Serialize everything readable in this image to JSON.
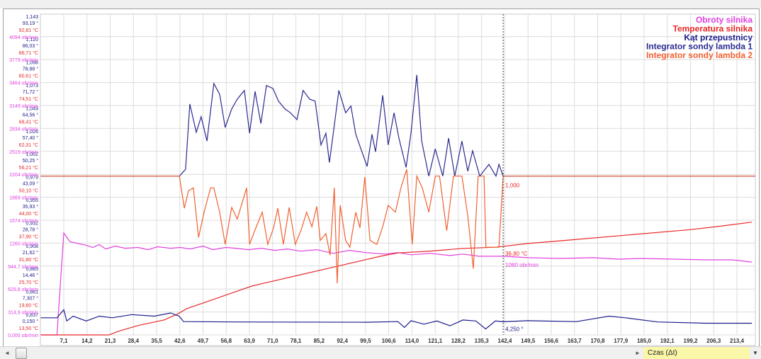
{
  "legend": [
    {
      "name": "Obroty silnika",
      "color": "#e040e0"
    },
    {
      "name": "Temperatura silnika",
      "color": "#e82828"
    },
    {
      "name": "Kąt przepustnicy",
      "color": "#1c1c8c"
    },
    {
      "name": "Integrator sondy lambda 1",
      "color": "#2a2a90"
    },
    {
      "name": "Integrator sondy lambda 2",
      "color": "#f06030"
    }
  ],
  "bottom": {
    "axis_select": "Czas (Δt)",
    "scroll_left": "◄",
    "scroll_right": "►",
    "dropdown": "▼"
  },
  "chart_data": {
    "type": "line",
    "xlabel": "Czas (Δt)",
    "xlim": [
      0,
      220
    ],
    "x_ticks": [
      "7,1",
      "14,2",
      "21,3",
      "28,4",
      "35,5",
      "42,6",
      "49,7",
      "56,8",
      "63,9",
      "71,0",
      "78,1",
      "85,2",
      "92,4",
      "99,5",
      "106,6",
      "114,0",
      "121,1",
      "128,2",
      "135,3",
      "142,4",
      "149,5",
      "156,6",
      "163,7",
      "170,8",
      "177,9",
      "185,0",
      "192,1",
      "199,2",
      "206,3",
      "213,4"
    ],
    "y_axes": {
      "lambda": {
        "min": 0.837,
        "step": 0.02355,
        "color": "#1c1c8c",
        "ticks": [
          "0,837",
          "0,861",
          "0,885",
          "0,908",
          "0,932",
          "0,955",
          "0,979",
          "1,002",
          "1,026",
          "1,049",
          "1,073",
          "1,096",
          "1,120",
          "1,143"
        ]
      },
      "angle": {
        "min": 0.15,
        "step": 7.157,
        "color": "#1c1c8c",
        "ticks": [
          "0,150 °",
          "7,307 °",
          "14,46 °",
          "21,62 °",
          "28,78 °",
          "35,93 °",
          "43,09 °",
          "50,25 °",
          "57,40 °",
          "64,56 °",
          "71,72 °",
          "78,88 °",
          "86,03 °",
          "93,19 °"
        ]
      },
      "temp": {
        "min": 13.5,
        "step": 6.1,
        "color": "#e82828",
        "ticks": [
          "13,50 °C",
          "19,60 °C",
          "25,70 °C",
          "31,80 °C",
          "37,90 °C",
          "44,00 °C",
          "50,10 °C",
          "56,21 °C",
          "62,31 °C",
          "68,41 °C",
          "74,51 °C",
          "80,61 °C",
          "86,71 °C",
          "92,81 °C"
        ]
      },
      "rpm": {
        "min": 0,
        "step": 314.9,
        "color": "#e040e0",
        "ticks": [
          "0,000 obr/min",
          "314,9 obr/min",
          "629,8 obr/min",
          "944,7 obr/min",
          "1260 obr/min",
          "1574 obr/min",
          "1889 obr/min",
          "2204 obr/min",
          "2519 obr/min",
          "2834 obr/min",
          "3149 obr/min",
          "3464 obr/min",
          "3779 obr/min",
          "4094 obr/min"
        ]
      }
    },
    "cursor": {
      "x": 142.4,
      "labels": [
        {
          "text": "1,000",
          "color": "#e82828",
          "axis": "lambda",
          "value": 0.995
        },
        {
          "text": "36,80 °C",
          "color": "#e82828",
          "axis": "temp",
          "value": 36.3
        },
        {
          "text": "1080 obr/min",
          "color": "#e040e0",
          "axis": "rpm",
          "value": 1020
        },
        {
          "text": "4,250 °",
          "color": "#1c1c8c",
          "axis": "angle",
          "value": 3.4
        }
      ]
    },
    "series": [
      {
        "name": "Obroty silnika",
        "axis": "rpm",
        "color": "#e040e0",
        "points": [
          [
            0,
            0
          ],
          [
            5,
            0
          ],
          [
            7.1,
            1400
          ],
          [
            9,
            1280
          ],
          [
            12,
            1250
          ],
          [
            14,
            1230
          ],
          [
            16,
            1200
          ],
          [
            18,
            1240
          ],
          [
            20,
            1180
          ],
          [
            23,
            1220
          ],
          [
            26,
            1190
          ],
          [
            30,
            1200
          ],
          [
            33,
            1170
          ],
          [
            36,
            1210
          ],
          [
            40,
            1190
          ],
          [
            43,
            1200
          ],
          [
            46,
            1180
          ],
          [
            50,
            1220
          ],
          [
            53,
            1170
          ],
          [
            57,
            1200
          ],
          [
            60,
            1190
          ],
          [
            64,
            1170
          ],
          [
            68,
            1190
          ],
          [
            72,
            1160
          ],
          [
            76,
            1180
          ],
          [
            80,
            1150
          ],
          [
            85,
            1170
          ],
          [
            90,
            1120
          ],
          [
            95,
            1160
          ],
          [
            100,
            1130
          ],
          [
            106,
            1110
          ],
          [
            110,
            1130
          ],
          [
            114,
            1100
          ],
          [
            120,
            1120
          ],
          [
            126,
            1090
          ],
          [
            130,
            1110
          ],
          [
            135,
            1080
          ],
          [
            142.4,
            1080
          ],
          [
            150,
            1060
          ],
          [
            160,
            1050
          ],
          [
            170,
            1060
          ],
          [
            178,
            1040
          ],
          [
            185,
            1050
          ],
          [
            195,
            1040
          ],
          [
            205,
            1030
          ],
          [
            213,
            1030
          ],
          [
            219,
            1000
          ]
        ]
      },
      {
        "name": "Temperatura silnika",
        "axis": "temp",
        "color": "#e82828",
        "points": [
          [
            0,
            13.5
          ],
          [
            21,
            13.5
          ],
          [
            24,
            14.5
          ],
          [
            30,
            16
          ],
          [
            38,
            17.5
          ],
          [
            42,
            19
          ],
          [
            45,
            20.5
          ],
          [
            50,
            22
          ],
          [
            55,
            23.5
          ],
          [
            60,
            25
          ],
          [
            65,
            26.5
          ],
          [
            70,
            27.5
          ],
          [
            75,
            28.5
          ],
          [
            80,
            29.5
          ],
          [
            85,
            30.5
          ],
          [
            90,
            31.5
          ],
          [
            95,
            32.5
          ],
          [
            100,
            33.5
          ],
          [
            105,
            34.5
          ],
          [
            110,
            35.3
          ],
          [
            120,
            35.8
          ],
          [
            130,
            36.5
          ],
          [
            140,
            36.8
          ],
          [
            150,
            37.8
          ],
          [
            165,
            38.9
          ],
          [
            180,
            40
          ],
          [
            200,
            41.5
          ],
          [
            210,
            42.5
          ],
          [
            219,
            43.5
          ]
        ]
      },
      {
        "name": "Kąt przepustnicy",
        "axis": "angle",
        "color": "#1c1c8c",
        "points": [
          [
            0,
            5.5
          ],
          [
            5,
            5.5
          ],
          [
            7.1,
            8
          ],
          [
            8,
            4.5
          ],
          [
            10,
            6
          ],
          [
            14,
            4.5
          ],
          [
            18,
            6
          ],
          [
            22,
            5.5
          ],
          [
            28,
            6.5
          ],
          [
            35,
            6
          ],
          [
            40,
            7
          ],
          [
            42.6,
            6
          ],
          [
            44,
            4.3
          ],
          [
            60,
            4.2
          ],
          [
            100,
            4.1
          ],
          [
            110,
            4.3
          ],
          [
            112,
            2.5
          ],
          [
            114,
            4.6
          ],
          [
            118,
            3.5
          ],
          [
            122,
            4.5
          ],
          [
            126,
            3
          ],
          [
            130,
            4.8
          ],
          [
            134,
            4.5
          ],
          [
            137,
            2
          ],
          [
            140,
            4.5
          ],
          [
            142.4,
            4.25
          ],
          [
            150,
            4.6
          ],
          [
            165,
            4.3
          ],
          [
            175,
            6
          ],
          [
            180,
            5.5
          ],
          [
            190,
            4.2
          ],
          [
            205,
            3.8
          ],
          [
            219,
            3.8
          ]
        ]
      },
      {
        "name": "Integrator sondy lambda 1",
        "axis": "lambda",
        "color": "#2a2a90",
        "points": [
          [
            0,
            1.0
          ],
          [
            42.7,
            1.0
          ],
          [
            44.6,
            1.007
          ],
          [
            45.9,
            1.074
          ],
          [
            47.9,
            1.045
          ],
          [
            49.4,
            1.061
          ],
          [
            51.2,
            1.036
          ],
          [
            53.3,
            1.095
          ],
          [
            55.1,
            1.084
          ],
          [
            56.8,
            1.05
          ],
          [
            58.8,
            1.069
          ],
          [
            60.5,
            1.079
          ],
          [
            62.7,
            1.088
          ],
          [
            64.3,
            1.044
          ],
          [
            66.0,
            1.087
          ],
          [
            67.8,
            1.054
          ],
          [
            69.5,
            1.093
          ],
          [
            71.5,
            1.09
          ],
          [
            73.2,
            1.077
          ],
          [
            75.2,
            1.069
          ],
          [
            76.9,
            1.065
          ],
          [
            78.9,
            1.058
          ],
          [
            80.8,
            1.088
          ],
          [
            82.8,
            1.079
          ],
          [
            84.5,
            1.077
          ],
          [
            86.3,
            1.032
          ],
          [
            87.8,
            1.044
          ],
          [
            88.9,
            1.014
          ],
          [
            90.2,
            1.047
          ],
          [
            91.8,
            1.088
          ],
          [
            93.9,
            1.065
          ],
          [
            95.5,
            1.072
          ],
          [
            97.0,
            1.043
          ],
          [
            98.7,
            1.027
          ],
          [
            100.5,
            1.01
          ],
          [
            102.0,
            1.043
          ],
          [
            103.1,
            1.025
          ],
          [
            105.3,
            1.083
          ],
          [
            107.0,
            1.032
          ],
          [
            108.8,
            1.065
          ],
          [
            110.3,
            1.039
          ],
          [
            112.5,
            1.009
          ],
          [
            114.0,
            1.044
          ],
          [
            115.8,
            1.104
          ],
          [
            117.3,
            1.036
          ],
          [
            119.5,
            1.0
          ],
          [
            121.5,
            1.028
          ],
          [
            123.8,
            1.0
          ],
          [
            125.6,
            1.039
          ],
          [
            127.5,
            1.0
          ],
          [
            129.7,
            1.036
          ],
          [
            131.5,
            1.005
          ],
          [
            133.0,
            1.026
          ],
          [
            135.2,
            1.0
          ],
          [
            138.0,
            1.012
          ],
          [
            140.2,
            1.0
          ],
          [
            141.1,
            1.012
          ],
          [
            142.4,
            1.0
          ],
          [
            220,
            1.0
          ]
        ]
      },
      {
        "name": "Integrator sondy lambda 2",
        "axis": "lambda",
        "color": "#f06030",
        "points": [
          [
            0,
            1.0
          ],
          [
            42.7,
            1.0
          ],
          [
            44.2,
            0.967
          ],
          [
            45.5,
            0.985
          ],
          [
            47.0,
            0.988
          ],
          [
            48.6,
            0.937
          ],
          [
            50.3,
            0.963
          ],
          [
            52.3,
            0.988
          ],
          [
            53.3,
            0.988
          ],
          [
            55.1,
            0.963
          ],
          [
            56.8,
            0.93
          ],
          [
            58.8,
            0.968
          ],
          [
            60.5,
            0.956
          ],
          [
            63.4,
            0.988
          ],
          [
            64.3,
            0.93
          ],
          [
            66.0,
            0.945
          ],
          [
            68.2,
            0.963
          ],
          [
            69.9,
            0.93
          ],
          [
            71.7,
            0.947
          ],
          [
            73.0,
            0.967
          ],
          [
            74.7,
            0.93
          ],
          [
            76.5,
            0.968
          ],
          [
            78.4,
            0.93
          ],
          [
            80.2,
            0.945
          ],
          [
            81.9,
            0.963
          ],
          [
            83.5,
            0.948
          ],
          [
            85.0,
            0.969
          ],
          [
            86.1,
            0.934
          ],
          [
            87.8,
            0.941
          ],
          [
            89.1,
            0.919
          ],
          [
            90.4,
            0.988
          ],
          [
            91.3,
            0.89
          ],
          [
            92.2,
            0.97
          ],
          [
            93.9,
            0.934
          ],
          [
            95.2,
            0.927
          ],
          [
            97.0,
            0.963
          ],
          [
            98.3,
            0.947
          ],
          [
            99.8,
            0.999
          ],
          [
            101.4,
            0.934
          ],
          [
            103.5,
            0.93
          ],
          [
            105.3,
            0.948
          ],
          [
            107.0,
            0.97
          ],
          [
            109.2,
            0.963
          ],
          [
            110.9,
            0.988
          ],
          [
            112.7,
            1.007
          ],
          [
            114.4,
            0.93
          ],
          [
            115.8,
            1.0
          ],
          [
            117.5,
            0.988
          ],
          [
            119.5,
            0.963
          ],
          [
            121.5,
            1.0
          ],
          [
            122.8,
            1.0
          ],
          [
            125.0,
            0.944
          ],
          [
            127.1,
            1.0
          ],
          [
            129.7,
            1.0
          ],
          [
            131.5,
            0.959
          ],
          [
            133.2,
            0.905
          ],
          [
            134.7,
            1.0
          ],
          [
            136.5,
            1.0
          ],
          [
            137.1,
            0.927
          ],
          [
            140.2,
            0.927
          ],
          [
            141.1,
            0.927
          ],
          [
            142.4,
            1.0
          ],
          [
            220,
            1.0
          ]
        ]
      }
    ]
  }
}
